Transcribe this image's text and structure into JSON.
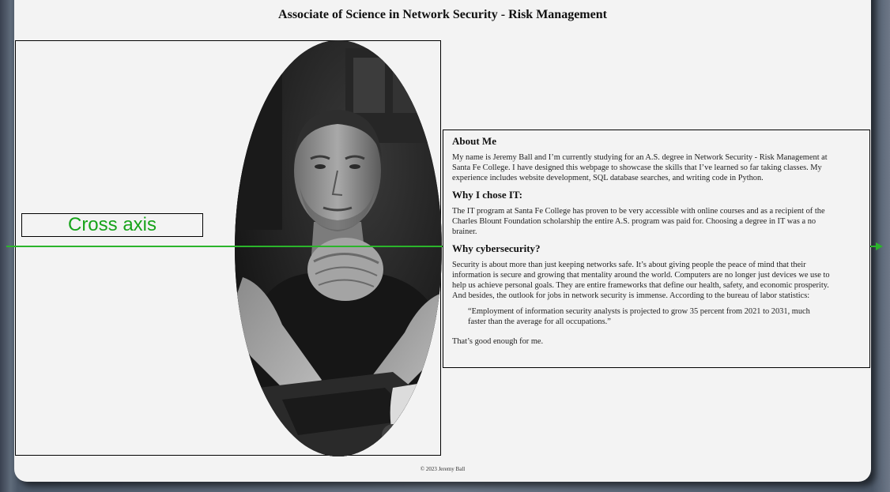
{
  "header": {
    "title": "Associate of Science in Network Security - Risk Management"
  },
  "overlay": {
    "cross_axis_label": "Cross axis",
    "accent_color": "#17a31a"
  },
  "about": {
    "heading": "About Me",
    "text": "My name is Jeremy Ball and I’m currently studying for an A.S. degree in Network Security - Risk Management at Santa Fe College. I have designed this webpage to showcase the skills that I’ve learned so far taking classes. My experience includes website development, SQL database searches, and writing code in Python."
  },
  "why_it": {
    "heading": "Why I chose IT:",
    "text": "The IT program at Santa Fe College has proven to be very accessible with online courses and as a recipient of the Charles Blount Foundation scholarship the entire A.S. program was paid for. Choosing a degree in IT was a no brainer."
  },
  "why_cyber": {
    "heading": "Why cybersecurity?",
    "text": "Security is about more than just keeping networks safe. It’s about giving people the peace of mind that their information is secure and growing that mentality around the world. Computers are no longer just devices we use to help us achieve personal goals. They are entire frameworks that define our health, safety, and economic prosperity. And besides, the outlook for jobs in network security is immense. According to the bureau of labor statistics:",
    "quote": "“Employment of information security analysts is projected to grow 35 percent from 2021 to 2031, much faster than the average for all occupations.”",
    "closing": "That’s good enough for me."
  },
  "footer": {
    "text": "© 2023 Jeremy Ball"
  }
}
